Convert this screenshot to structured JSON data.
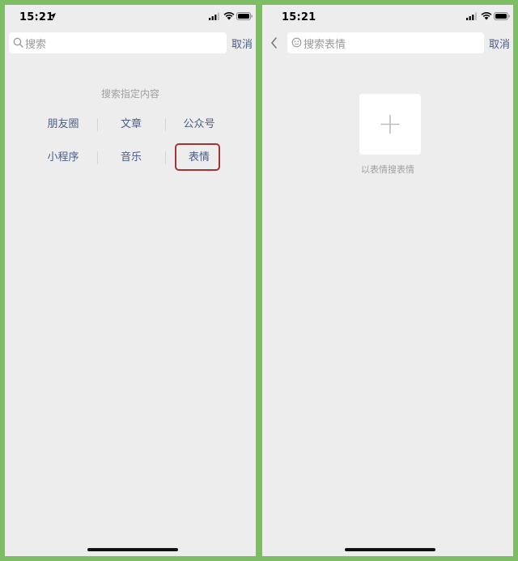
{
  "left_screen": {
    "status_time": "15:21",
    "search": {
      "placeholder": "搜索"
    },
    "cancel_label": "取消",
    "hint_title": "搜索指定内容",
    "categories": [
      "朋友圈",
      "文章",
      "公众号",
      "小程序",
      "音乐",
      "表情"
    ],
    "highlighted_category": "表情",
    "highlight_color": "#a33434"
  },
  "right_screen": {
    "status_time": "15:21",
    "search": {
      "placeholder": "搜索表情"
    },
    "cancel_label": "取消",
    "add_caption": "以表情搜表情"
  },
  "colors": {
    "frame": "#7cbd66",
    "screen_bg": "#ededed",
    "link": "#4a5d86",
    "hint": "#a0a0a0"
  },
  "icons": {
    "left": [
      "location-arrow-icon",
      "signal-icon",
      "wifi-icon",
      "battery-icon",
      "search-icon"
    ],
    "right": [
      "signal-icon",
      "wifi-icon",
      "battery-icon",
      "back-chevron-icon",
      "smiley-face-icon",
      "plus-icon"
    ]
  }
}
